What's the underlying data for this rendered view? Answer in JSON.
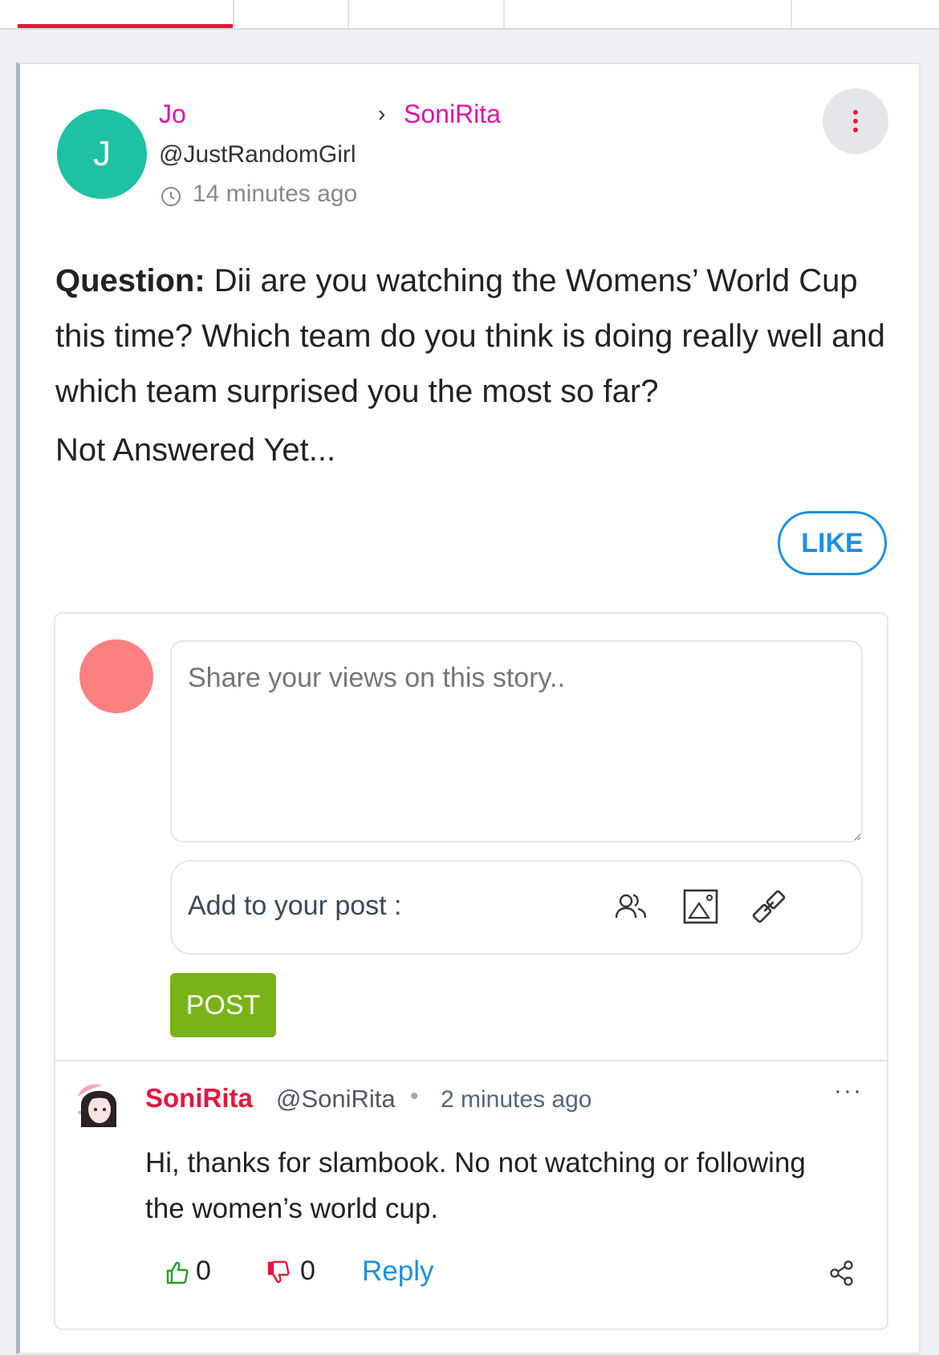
{
  "tabs": [
    {
      "name": "tab-1",
      "active": true
    },
    {
      "name": "tab-2",
      "active": false
    },
    {
      "name": "tab-3",
      "active": false
    },
    {
      "name": "tab-4",
      "active": false
    },
    {
      "name": "tab-5",
      "active": false
    }
  ],
  "post": {
    "avatar_initial": "J",
    "author": "Jo",
    "handle": "@JustRandomGirl",
    "recipient": "SoniRita",
    "timestamp": "14 minutes ago",
    "menu_icon": "vertical-ellipsis-icon",
    "question_label": "Question:",
    "question_text": " Dii are you watching the Womens’ World Cup this time? Which team do you think is doing really well and which team surprised you the most so far?",
    "answer_status": "Not Answered Yet...",
    "like_label": "LIKE"
  },
  "composer": {
    "placeholder": "Share your views on this story..",
    "add_label": "Add to your post :",
    "post_label": "POST",
    "icons": [
      "tag-people-icon",
      "image-icon",
      "link-icon"
    ]
  },
  "reply": {
    "author": "SoniRita",
    "handle": "@SoniRita",
    "separator": "•",
    "time": "2 minutes ago",
    "more": "···",
    "text": "Hi, thanks for slambook. No not watching or following the women’s world cup.",
    "upvotes": "0",
    "downvotes": "0",
    "reply_label": "Reply"
  },
  "colors": {
    "accent_pink": "#e012a8",
    "brand_red": "#e3173e",
    "link_blue": "#1d8fe3",
    "post_green": "#7ab317",
    "avatar_teal": "#1fc1a4"
  }
}
